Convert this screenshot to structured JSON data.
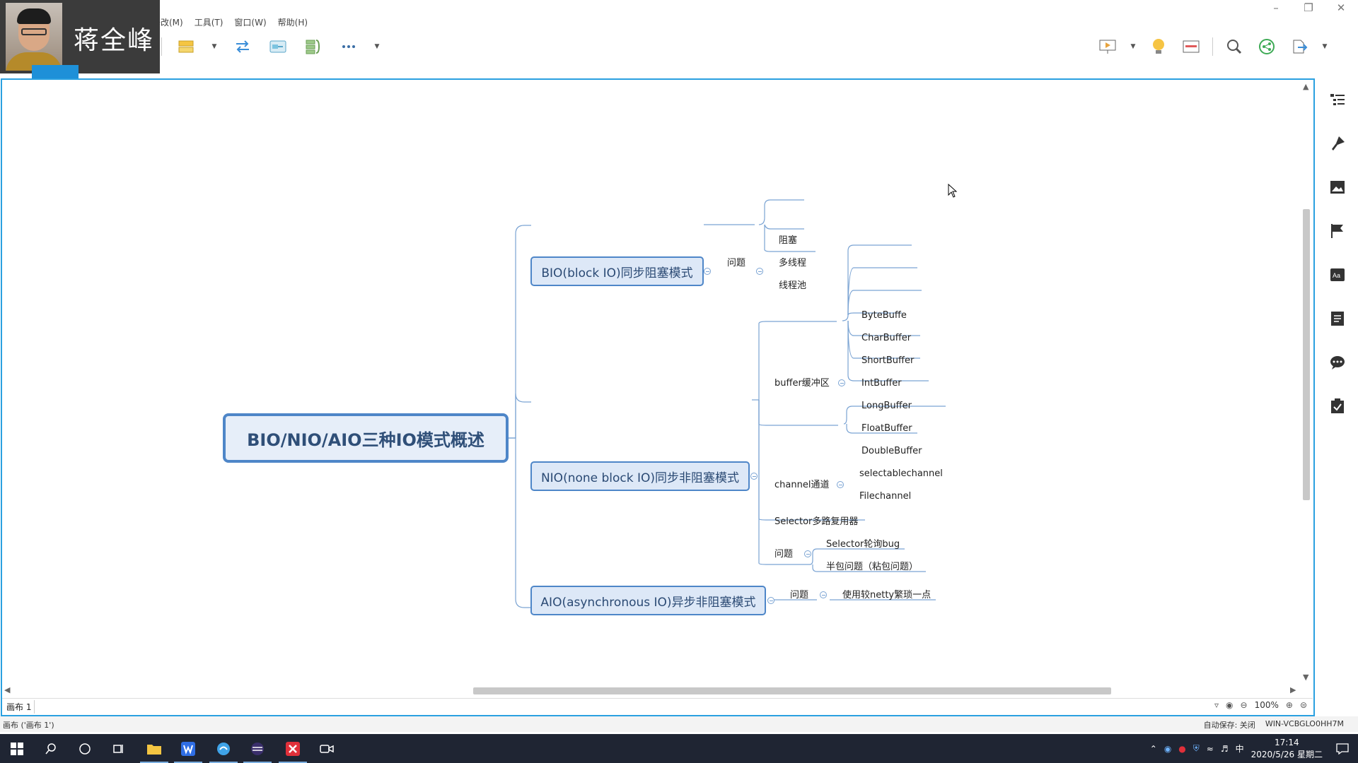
{
  "menu": {
    "items": [
      "修改(M)",
      "工具(T)",
      "窗口(W)",
      "帮助(H)"
    ]
  },
  "webcam": {
    "name": "蒋全峰"
  },
  "mindmap": {
    "central": "BIO/NIO/AIO三种IO模式概述",
    "bio": {
      "label": "BIO(block IO)同步阻塞模式",
      "problem": "问题",
      "items": [
        "阻塞",
        "多线程",
        "线程池"
      ]
    },
    "nio": {
      "label": "NIO(none block IO)同步非阻塞模式",
      "buffer": "buffer缓冲区",
      "buffers": [
        "ByteBuffe",
        "CharBuffer",
        "ShortBuffer",
        "IntBuffer",
        "LongBuffer",
        "FloatBuffer",
        "DoubleBuffer"
      ],
      "channel": "channel通道",
      "channels": [
        "selectablechannel",
        "Filechannel"
      ],
      "selector": "Selector多路复用器",
      "problem": "问题",
      "problems": [
        "Selector轮询bug",
        "半包问题（粘包问题）"
      ]
    },
    "aio": {
      "label": "AIO(asynchronous  IO)异步非阻塞模式",
      "problem": "问题",
      "item": "使用较netty繁琐一点"
    }
  },
  "sheet": {
    "tab": "画布 1",
    "zoom": "100%"
  },
  "status": {
    "left": "画布 ('画布 1')",
    "autosave": "自动保存: 关闭",
    "machine": "WIN-VCBGLO0HH7M"
  },
  "taskbar": {
    "time": "17:14",
    "date": "2020/5/26 星期二",
    "ime": "中"
  }
}
